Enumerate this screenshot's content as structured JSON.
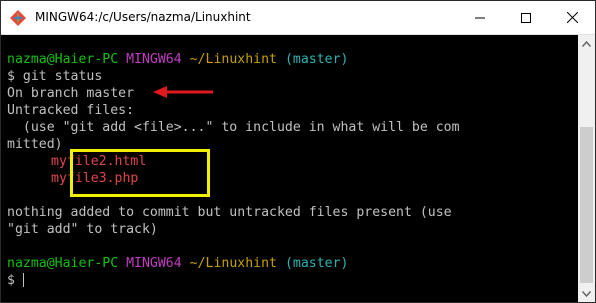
{
  "window": {
    "title": "MINGW64:/c/Users/nazma/Linuxhint"
  },
  "terminal": {
    "prompt1": {
      "user": "nazma@Haier-PC",
      "shell": "MINGW64",
      "path": "~/Linuxhint",
      "branch": "(master)"
    },
    "command": "$ git status",
    "output": [
      "On branch master",
      "Untracked files:",
      "  (use \"git add <file>...\" to include in what will be com",
      "mitted)"
    ],
    "untracked_files": [
      "myfile2.html",
      "myfile3.php"
    ],
    "output2": [
      "nothing added to commit but untracked files present (use",
      "\"git add\" to track)"
    ],
    "prompt2": {
      "user": "nazma@Haier-PC",
      "shell": "MINGW64",
      "path": "~/Linuxhint",
      "branch": "(master)"
    },
    "current_input": "$"
  },
  "colors": {
    "prompt_user": "#13c013",
    "prompt_shell": "#c13bc1",
    "prompt_path": "#c4a000",
    "prompt_branch": "#2bb3b3",
    "untracked_file": "#e0454c",
    "highlight_box": "#f2f200",
    "annotation_arrow": "#e0191f"
  },
  "icons": {
    "app": "git-bash-icon",
    "minimize": "minimize-icon",
    "maximize": "maximize-icon",
    "close": "close-icon",
    "scroll_up": "scroll-up-icon",
    "scroll_down": "scroll-down-icon"
  }
}
